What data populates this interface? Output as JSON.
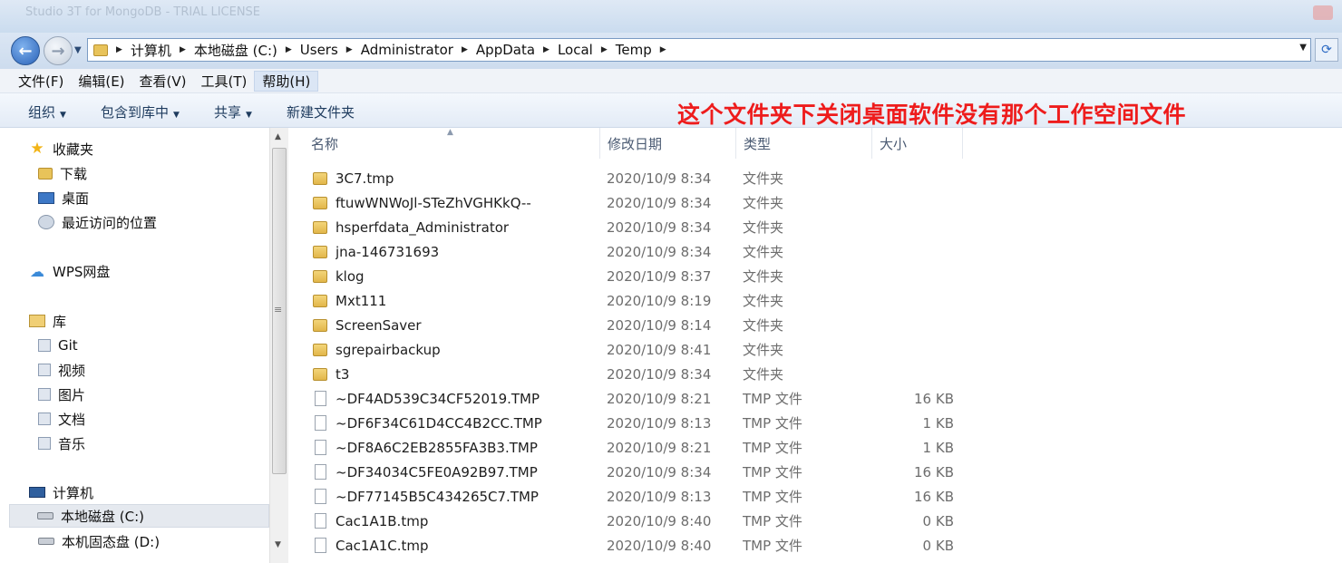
{
  "window": {
    "ghost_title": "Studio 3T for MongoDB - TRIAL LICENSE"
  },
  "nav": {
    "back_symbol": "←",
    "forward_symbol": "→",
    "refresh_symbol": "⟳",
    "breadcrumbs": [
      "计算机",
      "本地磁盘 (C:)",
      "Users",
      "Administrator",
      "AppData",
      "Local",
      "Temp"
    ]
  },
  "menubar": {
    "items": [
      "文件(F)",
      "编辑(E)",
      "查看(V)",
      "工具(T)",
      "帮助(H)"
    ]
  },
  "commandbar": {
    "organize": "组织",
    "include_in_library": "包含到库中",
    "share": "共享",
    "new_folder": "新建文件夹"
  },
  "annotation": "这个文件夹下关闭桌面软件没有那个工作空间文件",
  "navpane": {
    "favorites": "收藏夹",
    "downloads": "下载",
    "desktop": "桌面",
    "recent": "最近访问的位置",
    "wps": "WPS网盘",
    "libraries": "库",
    "git": "Git",
    "videos": "视频",
    "pictures": "图片",
    "documents": "文档",
    "music": "音乐",
    "computer": "计算机",
    "drive_c": "本地磁盘 (C:)",
    "drive_d": "本机固态盘 (D:)"
  },
  "columns": {
    "name": "名称",
    "date": "修改日期",
    "type": "类型",
    "size": "大小"
  },
  "files": [
    {
      "name": "3C7.tmp",
      "date": "2020/10/9 8:34",
      "type": "文件夹",
      "size": "",
      "kind": "folder"
    },
    {
      "name": "ftuwWNWoJl-STeZhVGHKkQ--",
      "date": "2020/10/9 8:34",
      "type": "文件夹",
      "size": "",
      "kind": "folder"
    },
    {
      "name": "hsperfdata_Administrator",
      "date": "2020/10/9 8:34",
      "type": "文件夹",
      "size": "",
      "kind": "folder"
    },
    {
      "name": "jna-146731693",
      "date": "2020/10/9 8:34",
      "type": "文件夹",
      "size": "",
      "kind": "folder"
    },
    {
      "name": "klog",
      "date": "2020/10/9 8:37",
      "type": "文件夹",
      "size": "",
      "kind": "folder"
    },
    {
      "name": "Mxt111",
      "date": "2020/10/9 8:19",
      "type": "文件夹",
      "size": "",
      "kind": "folder"
    },
    {
      "name": "ScreenSaver",
      "date": "2020/10/9 8:14",
      "type": "文件夹",
      "size": "",
      "kind": "folder"
    },
    {
      "name": "sgrepairbackup",
      "date": "2020/10/9 8:41",
      "type": "文件夹",
      "size": "",
      "kind": "folder"
    },
    {
      "name": "t3",
      "date": "2020/10/9 8:34",
      "type": "文件夹",
      "size": "",
      "kind": "folder"
    },
    {
      "name": "~DF4AD539C34CF52019.TMP",
      "date": "2020/10/9 8:21",
      "type": "TMP 文件",
      "size": "16 KB",
      "kind": "file"
    },
    {
      "name": "~DF6F34C61D4CC4B2CC.TMP",
      "date": "2020/10/9 8:13",
      "type": "TMP 文件",
      "size": "1 KB",
      "kind": "file"
    },
    {
      "name": "~DF8A6C2EB2855FA3B3.TMP",
      "date": "2020/10/9 8:21",
      "type": "TMP 文件",
      "size": "1 KB",
      "kind": "file"
    },
    {
      "name": "~DF34034C5FE0A92B97.TMP",
      "date": "2020/10/9 8:34",
      "type": "TMP 文件",
      "size": "16 KB",
      "kind": "file"
    },
    {
      "name": "~DF77145B5C434265C7.TMP",
      "date": "2020/10/9 8:13",
      "type": "TMP 文件",
      "size": "16 KB",
      "kind": "file"
    },
    {
      "name": "Cac1A1B.tmp",
      "date": "2020/10/9 8:40",
      "type": "TMP 文件",
      "size": "0 KB",
      "kind": "file"
    },
    {
      "name": "Cac1A1C.tmp",
      "date": "2020/10/9 8:40",
      "type": "TMP 文件",
      "size": "0 KB",
      "kind": "file"
    }
  ]
}
